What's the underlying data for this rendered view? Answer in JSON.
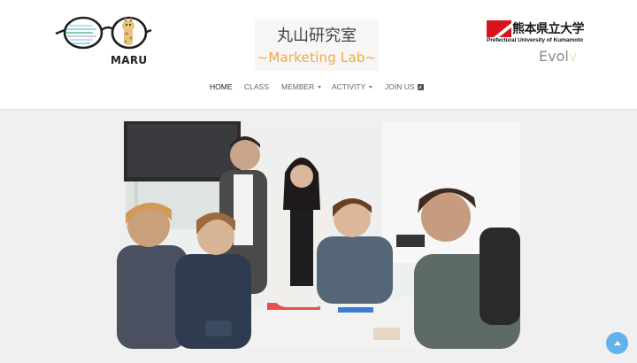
{
  "brand": {
    "logo_text": "MARU",
    "lab_name_jp": "丸山研究室",
    "lab_name_en": "~Marketing Lab~",
    "university_jp": "熊本県立大学",
    "university_en": "Prefectural University of Kumamoto",
    "evol_text": "Evol",
    "evol_accent": "v",
    "accent_color": "#f0a847",
    "university_red": "#d7141e"
  },
  "nav": {
    "items": [
      {
        "label": "HOME",
        "active": true,
        "dropdown": false
      },
      {
        "label": "CLASS",
        "active": false,
        "dropdown": false
      },
      {
        "label": "MEMBER",
        "active": false,
        "dropdown": true
      },
      {
        "label": "ACTIVITY",
        "active": false,
        "dropdown": true
      },
      {
        "label": "JOIN US",
        "active": false,
        "dropdown": false,
        "icon": "external-link-icon"
      }
    ]
  },
  "hero": {
    "icon": "hero-photo-icon"
  },
  "back_to_top": {
    "icon": "arrow-up-icon",
    "color": "#63b3ea"
  }
}
